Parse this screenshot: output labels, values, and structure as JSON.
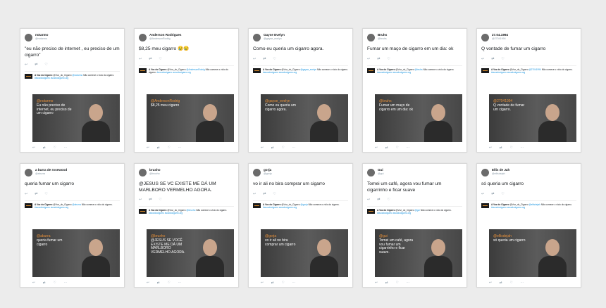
{
  "tweets": [
    {
      "user": "notarmo",
      "handle": "@notarmo",
      "text": "\"eu não preciso de internet , eu preciso de um cigarro\"",
      "vhandle": "@notarmo",
      "vquote": "Eu não preciso de internet, eu preciso de um cigarro"
    },
    {
      "user": "Anderson Rodrigues",
      "handle": "@AndersonRodrig",
      "text": "$8,25 meu cigarro 😢😢",
      "vhandle": "@AndersonRodrig",
      "vquote": "$8,25 meu cigarro"
    },
    {
      "user": "Gayse Evelyn",
      "handle": "@gayse_evelyn",
      "text": "Como eu queria um cigarro agora.",
      "vhandle": "@gayse_evelyn",
      "vquote": "Como eu queria um cigarro agora."
    },
    {
      "user": "Bruhs",
      "handle": "@bruhs",
      "text": "Fumar um maço de cigarro em um dia: ok",
      "vhandle": "@bruhs",
      "vquote": "Fumar um maço de cigarro em um dia: ok"
    },
    {
      "user": "27.04.1994",
      "handle": "@27041994",
      "text": "Q vontade de fumar um cigarro",
      "vhandle": "@27041994",
      "vquote": "Q vontade de fumar um cigarro."
    },
    {
      "user": "a burra de rosewood",
      "handle": "@aburra",
      "text": "queria fumar um cigarro",
      "vhandle": "@aburra",
      "vquote": "queria fumar um cigarro"
    },
    {
      "user": "bruxho",
      "handle": "@bruxho",
      "text": "@JESUS SE VC EXISTE ME DÁ UM MARLBORO VERMELHO AGORA.",
      "vhandle": "@bruxho",
      "vquote": "@JESUS SE VOCÊ EXISTE ME DÁ UM MARLBORO VERMELHO AGORA."
    },
    {
      "user": "gorja",
      "handle": "@gorja",
      "text": "vo ir ali no bira comprar um cigarro",
      "vhandle": "@gorja",
      "vquote": "vo ir ali no bira comprar um cigarro"
    },
    {
      "user": "Gui",
      "handle": "@gui",
      "text": "Tomei um café, agora vou fumar um cigarrinho e ficar suave",
      "vhandle": "@gui",
      "vquote": "Tomei um café, agora vou fumar um cigarrinho e ficar suave."
    },
    {
      "user": "Ellis de Jah",
      "handle": "@ellisdejah",
      "text": "só queria um cigarro",
      "vhandle": "@ellisdejah",
      "vquote": "só queria um cigarro"
    }
  ],
  "reply": {
    "account": "A Voz do Cigarro",
    "handle": "@Voz_do_Cigarro",
    "text": "Não comece o vício do cigarro.",
    "hashtag": "#avozdocigarro",
    "site": "avozdocigarro.org"
  },
  "actions": {
    "reply_icon": "reply-icon",
    "retweet_icon": "retweet-icon",
    "like_icon": "like-icon",
    "more_icon": "more-icon"
  }
}
